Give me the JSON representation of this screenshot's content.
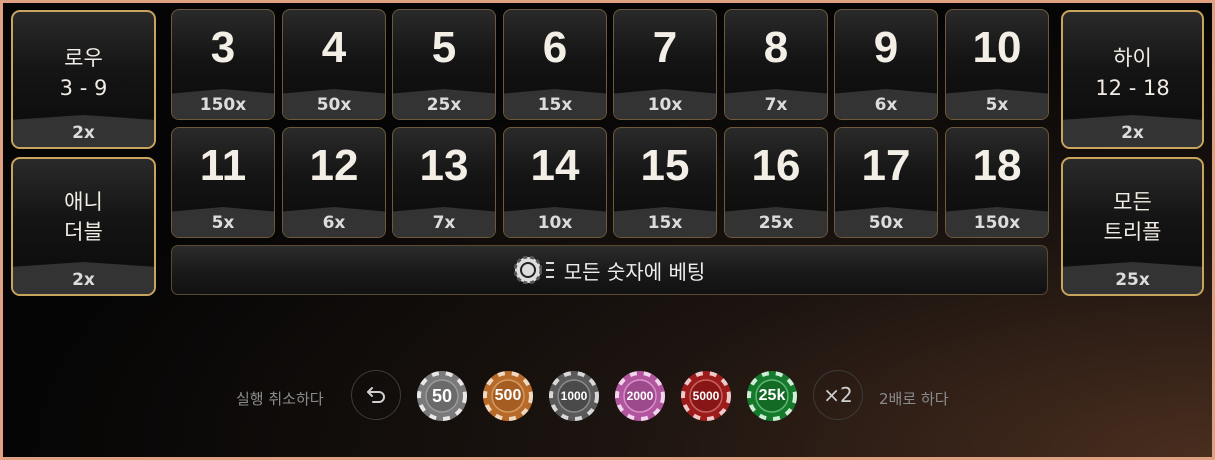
{
  "left_bets": [
    {
      "line1": "로우",
      "line2": "3 - 9",
      "payout": "2x"
    },
    {
      "line1": "애니",
      "line2": "더블",
      "payout": "2x"
    }
  ],
  "right_bets": [
    {
      "line1": "하이",
      "line2": "12 - 18",
      "payout": "2x"
    },
    {
      "line1": "모든",
      "line2": "트리플",
      "payout": "25x"
    }
  ],
  "numbers_row1": [
    {
      "n": "3",
      "payout": "150x"
    },
    {
      "n": "4",
      "payout": "50x"
    },
    {
      "n": "5",
      "payout": "25x"
    },
    {
      "n": "6",
      "payout": "15x"
    },
    {
      "n": "7",
      "payout": "10x"
    },
    {
      "n": "8",
      "payout": "7x"
    },
    {
      "n": "9",
      "payout": "6x"
    },
    {
      "n": "10",
      "payout": "5x"
    }
  ],
  "numbers_row2": [
    {
      "n": "11",
      "payout": "5x"
    },
    {
      "n": "12",
      "payout": "6x"
    },
    {
      "n": "13",
      "payout": "7x"
    },
    {
      "n": "14",
      "payout": "10x"
    },
    {
      "n": "15",
      "payout": "15x"
    },
    {
      "n": "16",
      "payout": "25x"
    },
    {
      "n": "17",
      "payout": "50x"
    },
    {
      "n": "18",
      "payout": "150x"
    }
  ],
  "bet_all_label": "모든 숫자에 베팅",
  "controls": {
    "undo_label": "실행 취소하다",
    "double_label": "2배로 하다",
    "double_symbol": "×2",
    "undo_icon": "undo-arrow-icon"
  },
  "chips": [
    {
      "label": "50",
      "color": "#7a7a7a"
    },
    {
      "label": "500",
      "color": "#b86a2a"
    },
    {
      "label": "1000",
      "color": "#5a5a5a"
    },
    {
      "label": "2000",
      "color": "#b0559e"
    },
    {
      "label": "5000",
      "color": "#9c1c1c"
    },
    {
      "label": "25k",
      "color": "#167a2c"
    }
  ],
  "colors": {
    "gold": "#c9a45c",
    "panel": "#141414"
  }
}
